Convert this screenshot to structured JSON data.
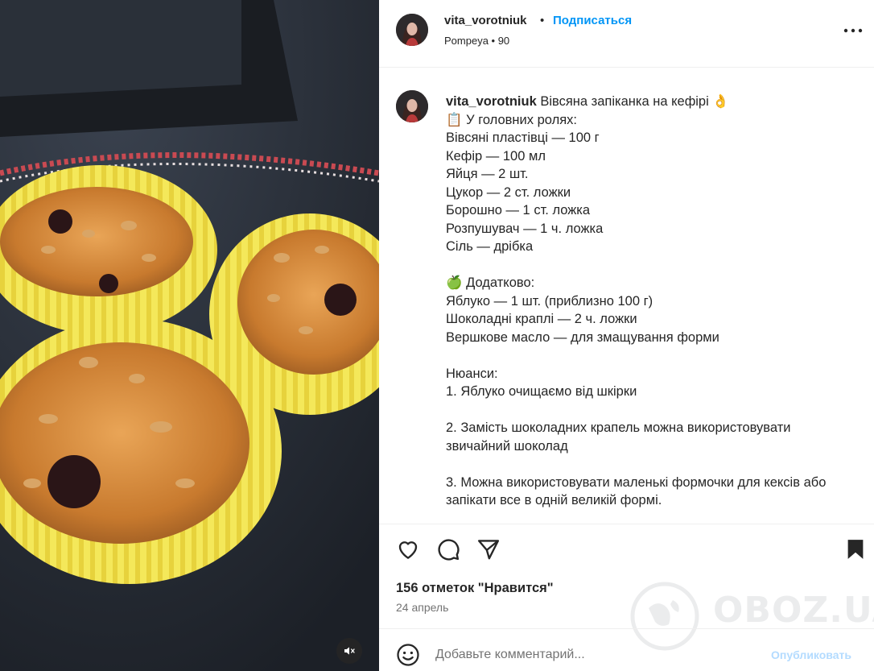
{
  "post": {
    "username": "vita_vorotniuk",
    "separator": "•",
    "follow_label": "Подписаться",
    "location": "Pompeya • 90",
    "caption_title": "Вівсяна запіканка на кефірі 👌",
    "caption_body": "\n📋 У головних ролях:\nВівсяні пластівці — 100 г\nКефір — 100 мл\nЯйця — 2 шт.\nЦукор — 2 ст. ложки\nБорошно — 1 ст. ложка\nРозпушувач — 1 ч. ложка\nСіль — дрібка\n\n🍏 Додатково:\nЯблуко — 1 шт. (приблизно 100 г)\nШоколадні краплі — 2 ч. ложки\nВершкове масло — для змащування форми\n\nНюанси:\n1. Яблуко очищаємо від шкірки\n\n2. Замість шоколадних крапель можна використовувати звичайний шоколад\n\n3. Можна використовувати маленькі формочки для кексів або запікати все в одній великій формі.",
    "likes": "156 отметок \"Нравится\"",
    "date": "24 апрель"
  },
  "comment": {
    "placeholder": "Добавьте комментарий...",
    "publish_label": "Опубликовать"
  },
  "watermark": {
    "text": "OBOZ.UA"
  },
  "icons": {
    "more": "more-horizontal-icon",
    "like": "heart-icon",
    "comment": "comment-icon",
    "share": "send-icon",
    "save": "bookmark-icon",
    "emoji": "emoji-icon",
    "mute": "speaker-muted-icon"
  },
  "colors": {
    "link": "#0095f6",
    "publish_disabled": "#b3dbff",
    "secondary_text": "#737373",
    "divider": "#efefef"
  }
}
